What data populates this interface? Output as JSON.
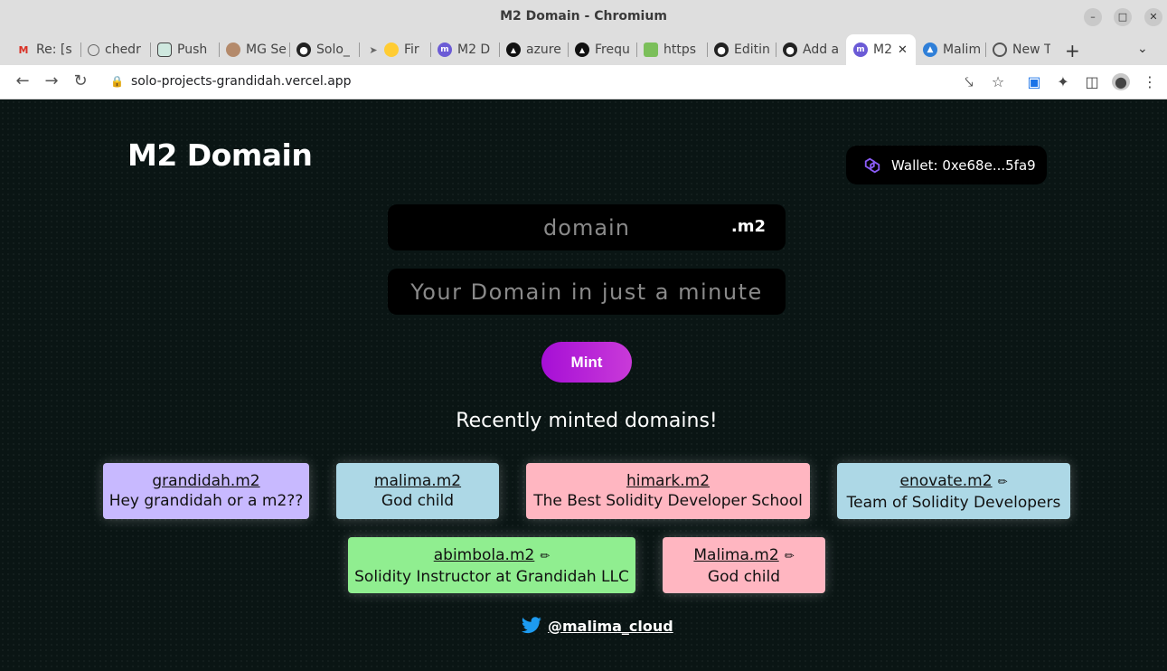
{
  "window": {
    "title": "M2 Domain - Chromium"
  },
  "tabs": [
    {
      "label": "Re: [s",
      "icon": "gmail-icon"
    },
    {
      "label": "chedr",
      "icon": "globe-icon"
    },
    {
      "label": "Push",
      "icon": "openai-icon"
    },
    {
      "label": "MG Se",
      "icon": "avatar-icon"
    },
    {
      "label": "Solo_",
      "icon": "github-icon"
    },
    {
      "label": "Fir",
      "icon": "party-icon"
    },
    {
      "label": "M2 D",
      "icon": "m2-icon"
    },
    {
      "label": "azure",
      "icon": "vercel-icon"
    },
    {
      "label": "Frequ",
      "icon": "vercel-icon"
    },
    {
      "label": "https",
      "icon": "money-icon"
    },
    {
      "label": "Editin",
      "icon": "github-icon"
    },
    {
      "label": "Add a",
      "icon": "github-icon"
    },
    {
      "label": "M2",
      "icon": "m2-icon"
    },
    {
      "label": "Malim",
      "icon": "app-icon"
    },
    {
      "label": "New T",
      "icon": "chrome-icon"
    }
  ],
  "address_bar": {
    "url": "solo-projects-grandidah.vercel.app"
  },
  "app": {
    "logo": "M2 Domain",
    "wallet": "Wallet: 0xe68e...5fa9",
    "domain_placeholder": "domain",
    "tld": ".m2",
    "record_placeholder": "Your Domain in just a minute",
    "mint_label": "Mint",
    "recent_title": "Recently minted domains!",
    "twitter_handle": "@malima_cloud"
  },
  "domains": [
    {
      "name": "grandidah.m2",
      "record": "Hey grandidah or a m2??",
      "color": "#c8b9ff",
      "editable": false
    },
    {
      "name": "malima.m2",
      "record": "God child",
      "color": "#add8e6",
      "editable": false
    },
    {
      "name": "himark.m2",
      "record": "The Best Solidity Developer School",
      "color": "#ffb6c1",
      "editable": false
    },
    {
      "name": "enovate.m2",
      "record": "Team of Solidity Developers",
      "color": "#add8e6",
      "editable": true
    },
    {
      "name": "abimbola.m2",
      "record": "Solidity Instructor at Grandidah LLC",
      "color": "#90ee90",
      "editable": true
    },
    {
      "name": "Malima.m2",
      "record": "God child",
      "color": "#ffb6c1",
      "editable": true
    }
  ]
}
